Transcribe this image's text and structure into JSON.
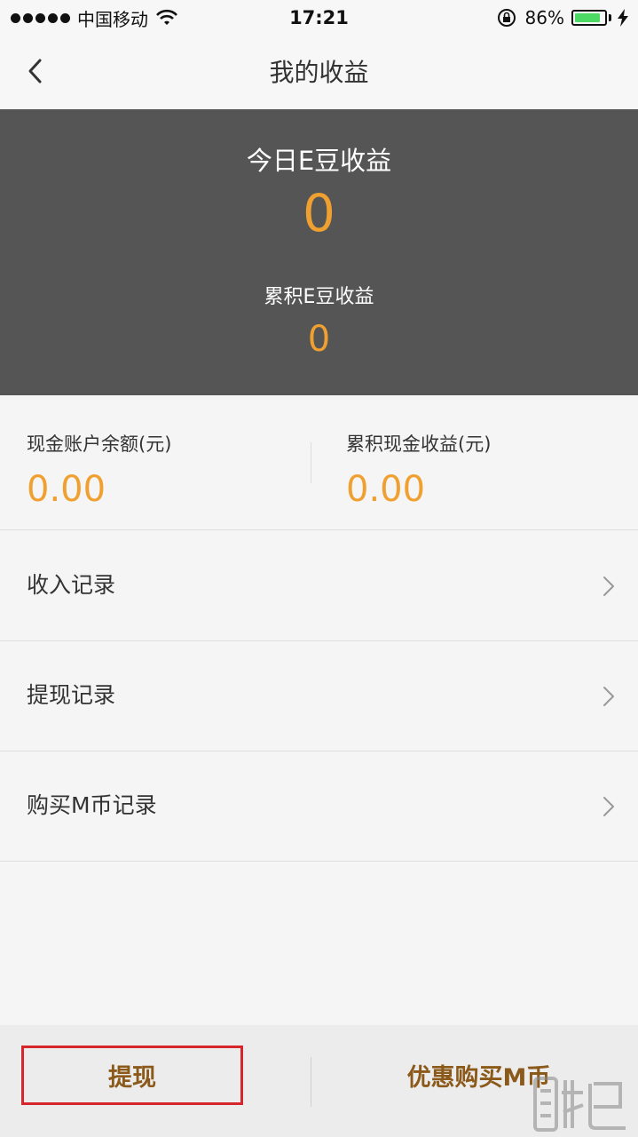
{
  "status_bar": {
    "carrier": "中国移动",
    "time": "17:21",
    "battery": "86%",
    "battery_level": 0.86,
    "battery_color": "#4cd964"
  },
  "nav": {
    "title": "我的收益",
    "back_icon": "chevron-left-icon"
  },
  "bean_panel": {
    "today_label": "今日E豆收益",
    "today_value": "0",
    "total_label": "累积E豆收益",
    "total_value": "0",
    "background": "#555555",
    "accent": "#f0a030"
  },
  "cash": {
    "balance_label": "现金账户余额(元)",
    "balance_value": "0.00",
    "total_label": "累积现金收益(元)",
    "total_value": "0.00"
  },
  "records": [
    {
      "label": "收入记录"
    },
    {
      "label": "提现记录"
    },
    {
      "label": "购买M币记录"
    }
  ],
  "bottom_bar": {
    "withdraw_label": "提现",
    "buy_label": "优惠购买M币",
    "highlight_color": "#d7262b",
    "text_color": "#8b5a1a"
  }
}
